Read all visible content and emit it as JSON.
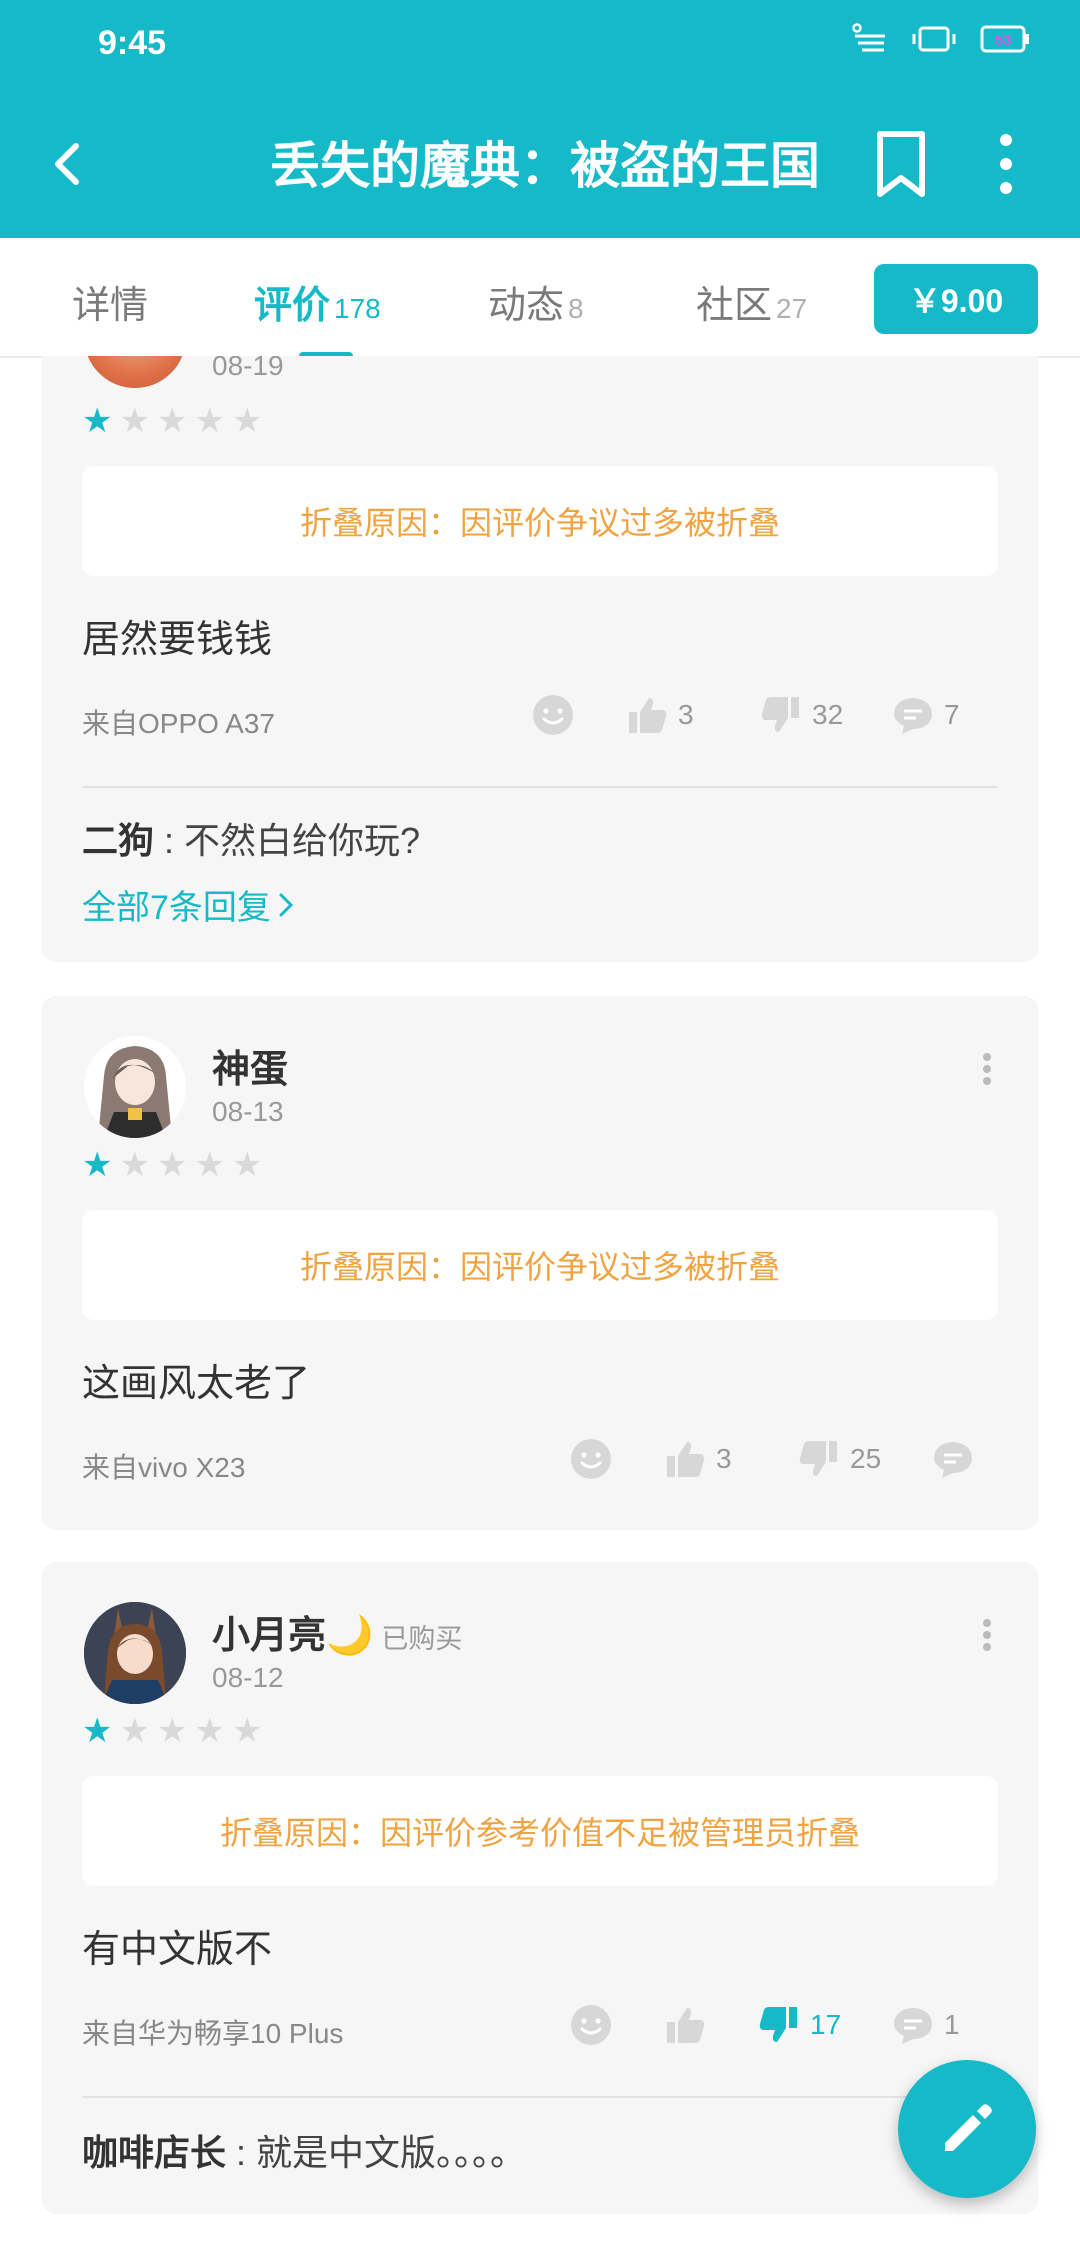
{
  "status_bar": {
    "time": "9:45",
    "battery": "53"
  },
  "app_bar": {
    "title": "丢失的魔典：被盗的王国"
  },
  "tabs": [
    {
      "label": "详情",
      "count": ""
    },
    {
      "label": "评价",
      "count": "178"
    },
    {
      "label": "动态",
      "count": "8"
    },
    {
      "label": "社区",
      "count": "27"
    }
  ],
  "price_button": "￥9.00",
  "reviews": [
    {
      "date": "08-19",
      "rating": 1,
      "fold_label": "折叠原因：",
      "fold_reason": "因评价争议过多被折叠",
      "text": "居然要钱钱",
      "device": "来自OPPO A37",
      "likes": "3",
      "dislikes": "32",
      "comments": "7",
      "reply": {
        "author": "二狗",
        "sep": " : ",
        "text": "不然白给你玩?"
      },
      "more_replies": "全部7条回复"
    },
    {
      "username": "神蛋",
      "date": "08-13",
      "rating": 1,
      "fold_label": "折叠原因：",
      "fold_reason": "因评价争议过多被折叠",
      "text": "这画风太老了",
      "device": "来自vivo X23",
      "likes": "3",
      "dislikes": "25",
      "comments": ""
    },
    {
      "username": "小月亮",
      "emoji": "🌙",
      "badge": "已购买",
      "date": "08-12",
      "rating": 1,
      "fold_label": "折叠原因：",
      "fold_reason": "因评价参考价值不足被管理员折叠",
      "text": "有中文版不",
      "device": "来自华为畅享10 Plus",
      "likes": "",
      "dislikes": "17",
      "comments": "1",
      "reply": {
        "author": "咖啡店长",
        "sep": " : ",
        "text": "就是中文版。。。。"
      }
    }
  ],
  "colors": {
    "accent": "#15b9c8",
    "fold_text": "#f0a340",
    "card_bg": "#f6f6f6"
  },
  "icons": [
    "back-arrow-icon",
    "bookmark-icon",
    "more-vert-icon",
    "star-icon",
    "emoji-icon",
    "thumb-up-icon",
    "thumb-down-icon",
    "comment-icon",
    "edit-pencil-icon"
  ]
}
